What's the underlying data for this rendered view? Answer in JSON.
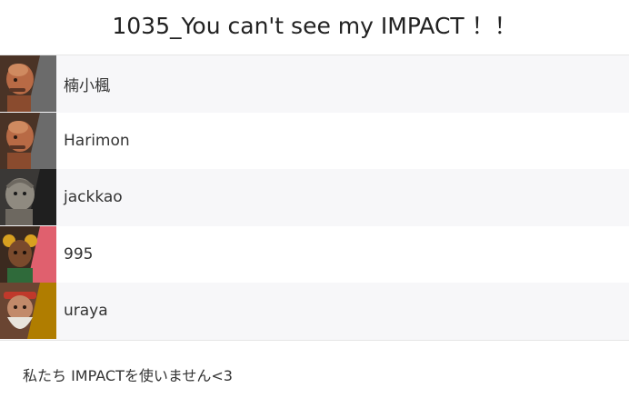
{
  "team": {
    "title": "1035_You can't see my IMPACT ！！",
    "motto": "私たち IMPACTを使いません<3"
  },
  "members": [
    {
      "name": "楠小楓",
      "avatar_icon": "bald-fighter-portrait-icon",
      "corner_color": "#6b6b6b",
      "bg_color": "#3a2a22",
      "skin_color": "#b86a45"
    },
    {
      "name": "Harimon",
      "avatar_icon": "bald-fighter-portrait-icon",
      "corner_color": "#6b6b6b",
      "bg_color": "#3a2a22",
      "skin_color": "#b86a45"
    },
    {
      "name": "jackkao",
      "avatar_icon": "stone-fighter-portrait-icon",
      "corner_color": "#1f1f1f",
      "bg_color": "#2b2b2b",
      "skin_color": "#8f8a80"
    },
    {
      "name": "995",
      "avatar_icon": "braided-fighter-portrait-icon",
      "corner_color": "#e0606e",
      "bg_color": "#4a2f24",
      "skin_color": "#7a4a2c"
    },
    {
      "name": "uraya",
      "avatar_icon": "old-master-portrait-icon",
      "corner_color": "#b07d00",
      "bg_color": "#5a3a2a",
      "skin_color": "#c28a6a"
    }
  ]
}
